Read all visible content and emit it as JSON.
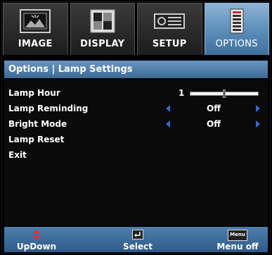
{
  "tabs": [
    {
      "label": "IMAGE",
      "icon": "image-icon",
      "active": false
    },
    {
      "label": "DISPLAY",
      "icon": "display-icon",
      "active": false
    },
    {
      "label": "SETUP",
      "icon": "setup-icon",
      "active": false
    },
    {
      "label": "OPTIONS",
      "icon": "options-icon",
      "active": true
    }
  ],
  "header": {
    "title": "Options | Lamp Settings"
  },
  "menu": {
    "lamp_hour": {
      "label": "Lamp Hour",
      "value": "1"
    },
    "lamp_reminding": {
      "label": "Lamp Reminding",
      "value": "Off"
    },
    "bright_mode": {
      "label": "Bright Mode",
      "value": "Off"
    },
    "lamp_reset": {
      "label": "Lamp Reset"
    },
    "exit": {
      "label": "Exit"
    }
  },
  "footer": {
    "updown": {
      "label": "UpDown",
      "icon": "updown-arrows-icon"
    },
    "select": {
      "label": "Select",
      "icon": "enter-key-icon"
    },
    "menu_off": {
      "label": "Menu off",
      "icon": "menu-key-icon",
      "key_text": "Menu"
    }
  },
  "colors": {
    "accent": "#4f7fae",
    "active_tab": "#5e8fbb",
    "arrow": "#2f6fd6",
    "updown_icon": "#e03030"
  }
}
